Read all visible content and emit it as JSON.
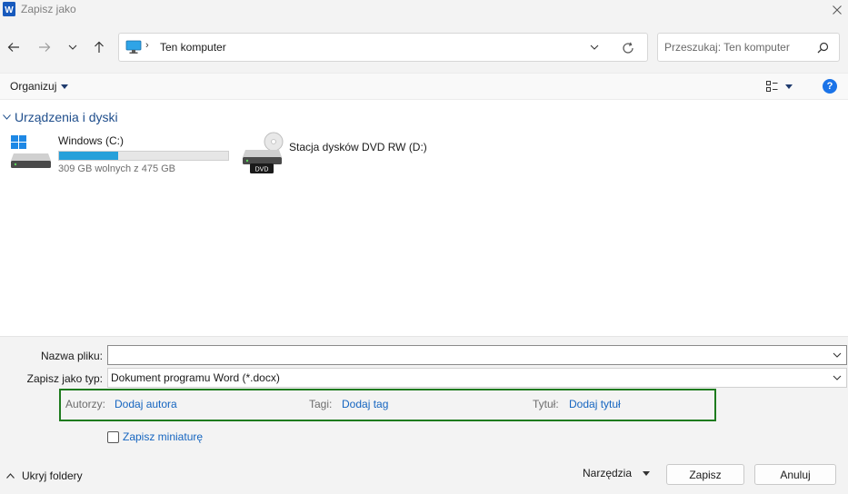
{
  "window": {
    "title": "Zapisz jako"
  },
  "address_bar": {
    "path": "Ten komputer",
    "separator": "›"
  },
  "search": {
    "placeholder": "Przeszukaj: Ten komputer"
  },
  "command_bar": {
    "organize_label": "Organizuj",
    "help_glyph": "?"
  },
  "group": {
    "title": "Urządzenia i dyski"
  },
  "drives": [
    {
      "name": "Windows (C:)",
      "free_text": "309 GB wolnych z 475 GB",
      "used_fraction": 0.35
    },
    {
      "name": "Stacja dysków DVD RW (D:)",
      "badge": "DVD"
    }
  ],
  "form": {
    "filename_label": "Nazwa pliku:",
    "filename_value": "",
    "filetype_label": "Zapisz jako typ:",
    "filetype_value": "Dokument programu Word (*.docx)"
  },
  "metadata": {
    "authors_label": "Autorzy:",
    "authors_link": "Dodaj autora",
    "tags_label": "Tagi:",
    "tags_link": "Dodaj tag",
    "title_label": "Tytuł:",
    "title_link": "Dodaj tytuł"
  },
  "thumbnail": {
    "label": "Zapisz miniaturę",
    "checked": false
  },
  "footer": {
    "hide_folders_label": "Ukryj foldery",
    "tools_label": "Narzędzia",
    "save_label": "Zapisz",
    "cancel_label": "Anuluj"
  },
  "colors": {
    "accent": "#26a0da",
    "link": "#1565c0",
    "highlight_box": "#1e7b1e",
    "word_blue": "#185abd"
  }
}
